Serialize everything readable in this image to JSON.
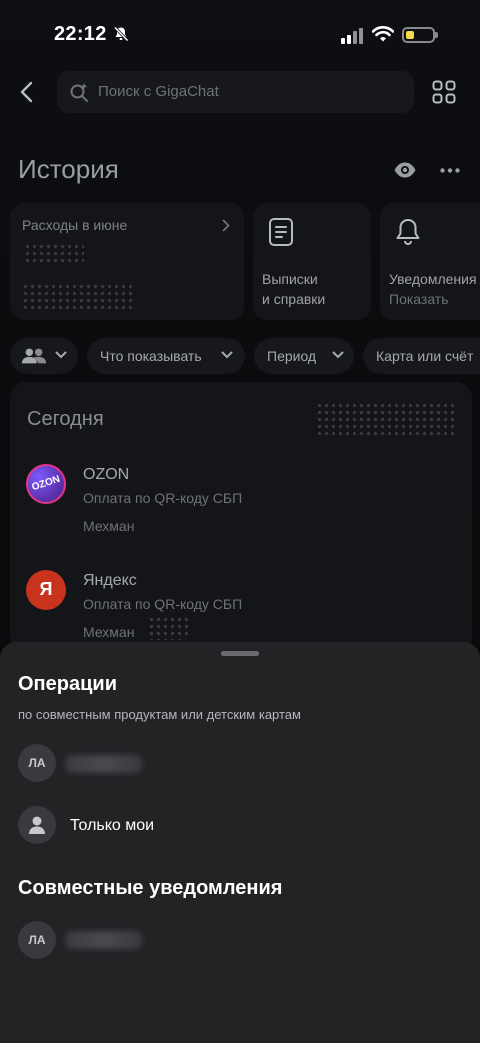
{
  "status": {
    "time": "22:12"
  },
  "search": {
    "placeholder": "Поиск с GigaChat"
  },
  "page": {
    "title": "История"
  },
  "cards": {
    "expenses_label": "Расходы в июне",
    "statements_line1": "Выписки",
    "statements_line2": "и справки",
    "notifications_line1": "Уведомления",
    "notifications_line2": "Показать"
  },
  "filters": {
    "show_label": "Что показывать",
    "period_label": "Период",
    "card_label": "Карта или счёт"
  },
  "list": {
    "section_title": "Сегодня",
    "transactions": [
      {
        "name": "OZON",
        "subtitle": "Оплата по QR-коду СБП",
        "category": "Мехман",
        "logo_text": "OZON"
      },
      {
        "name": "Яндекс",
        "subtitle": "Оплата по QR-коду СБП",
        "category": "Мехман",
        "logo_text": "Я"
      }
    ]
  },
  "sheet": {
    "title": "Операции",
    "subtitle": "по совместным продуктам или детским картам",
    "options": [
      {
        "avatar": "ЛА"
      },
      {
        "label": "Только мои"
      }
    ],
    "section2_title": "Совместные уведомления",
    "section2_items": [
      {
        "avatar": "ЛА"
      }
    ]
  },
  "colors": {
    "background": "#0a0a0a",
    "card": "#141518",
    "sheet": "#232326",
    "battery_fill": "#f5d94a",
    "yandex_red": "#c8331e"
  }
}
